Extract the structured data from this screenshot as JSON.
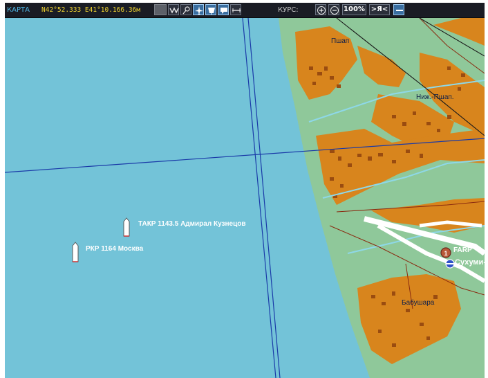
{
  "toolbar": {
    "title": "КАРТА",
    "coordinates": "N42°52.333 E41°10.166.36м",
    "course_label": "КУРС:",
    "zoom": "100%",
    "self_button": ">Я<",
    "tool_icons": [
      "snake-route-icon",
      "pin-icon",
      "aircraft-filter-icon",
      "ship-filter-icon",
      "chat-icon",
      "ruler-icon"
    ],
    "zoom_in_icon": "zoom-in-icon",
    "zoom_out_icon": "zoom-out-icon",
    "mode_icon": "line-mode-icon"
  },
  "map": {
    "colors": {
      "sea": "#73c3d8",
      "land": "#8fc89a",
      "urban": "#d8851d",
      "buildings": "#9a4c10",
      "river": "#8ed8e8",
      "route": "#1a3aa8",
      "road": "#8a2a10",
      "runway": "#ffffff"
    },
    "ships": [
      {
        "label": "ТАКР 1143.5 Адмирал Кузнецов",
        "icon": "ship-icon"
      },
      {
        "label": "РКР 1164 Москва",
        "icon": "ship-icon"
      }
    ],
    "towns": [
      {
        "label": "Пшап"
      },
      {
        "label": "Ниж.-Пшап."
      },
      {
        "label": "Бабушара"
      }
    ],
    "airfield": {
      "farp_label": "FARP",
      "farp_icon": "farp-icon",
      "airfield_label": "Сухуми-Б",
      "airfield_icon": "airfield-icon"
    }
  }
}
